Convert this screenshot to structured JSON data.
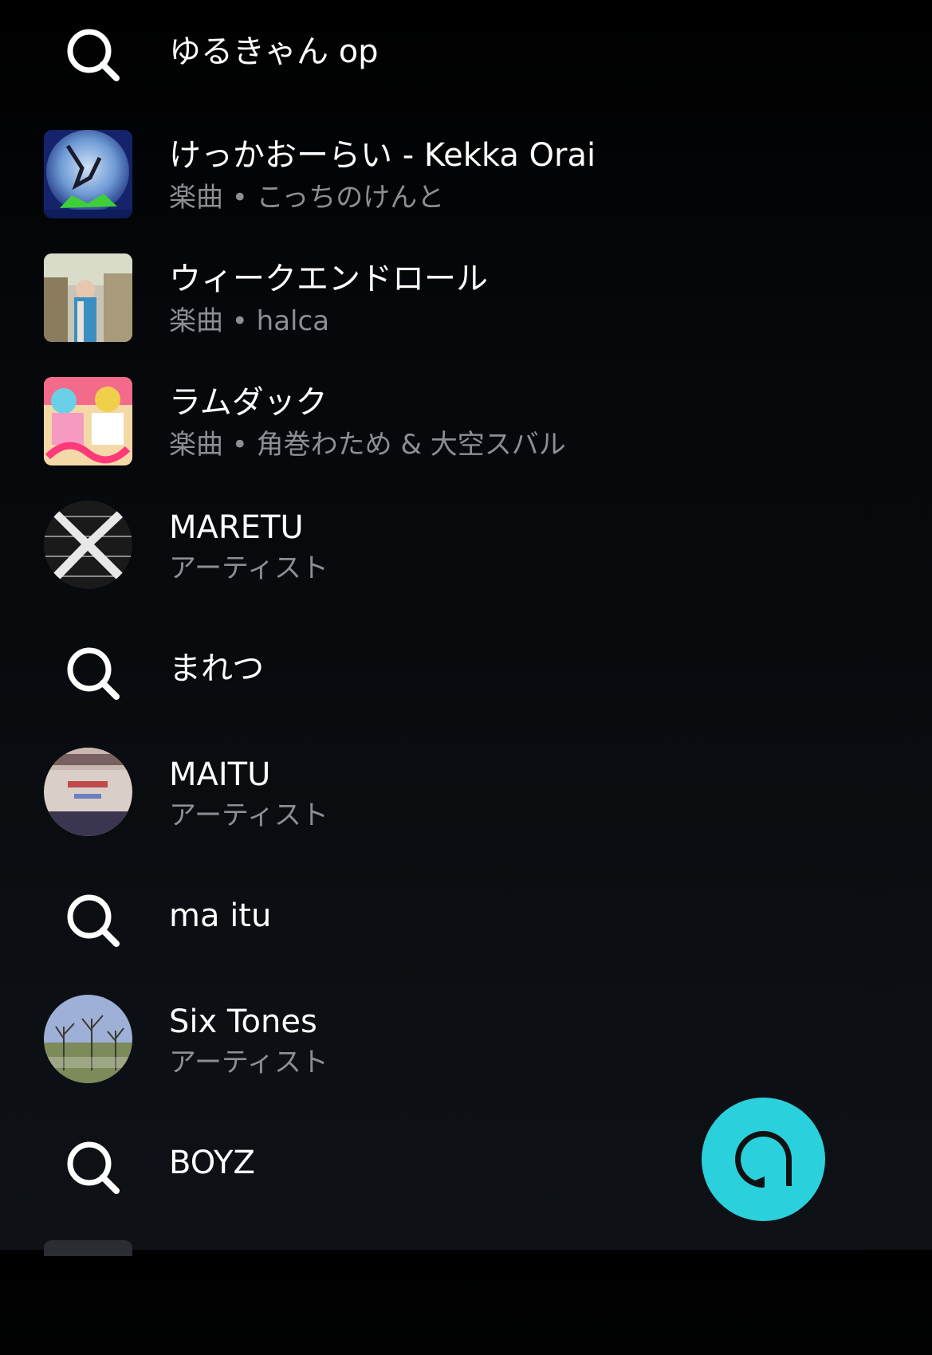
{
  "colors": {
    "background": "#05070a",
    "primary_text": "#ffffff",
    "secondary_text": "#8b8f94",
    "alexa_accent": "#2ad1dc"
  },
  "results": [
    {
      "kind": "suggestion",
      "icon": "search-icon",
      "title": "ゆるきゃん op"
    },
    {
      "kind": "song",
      "title": "けっかおーらい - Kekka Orai",
      "subtitle": "楽曲 • こっちのけんと"
    },
    {
      "kind": "song",
      "title": "ウィークエンドロール",
      "subtitle": "楽曲 • halca"
    },
    {
      "kind": "song",
      "title": "ラムダック",
      "subtitle": "楽曲 • 角巻わため & 大空スバル"
    },
    {
      "kind": "artist",
      "title": "MARETU",
      "subtitle": "アーティスト"
    },
    {
      "kind": "suggestion",
      "icon": "search-icon",
      "title": "まれつ"
    },
    {
      "kind": "artist",
      "title": "MAITU",
      "subtitle": "アーティスト"
    },
    {
      "kind": "suggestion",
      "icon": "search-icon",
      "title": "ma itu"
    },
    {
      "kind": "artist",
      "title": "Six Tones",
      "subtitle": "アーティスト"
    },
    {
      "kind": "suggestion",
      "icon": "search-icon",
      "title": "BOYZ"
    }
  ],
  "alexa_button": {
    "icon": "alexa-icon"
  }
}
